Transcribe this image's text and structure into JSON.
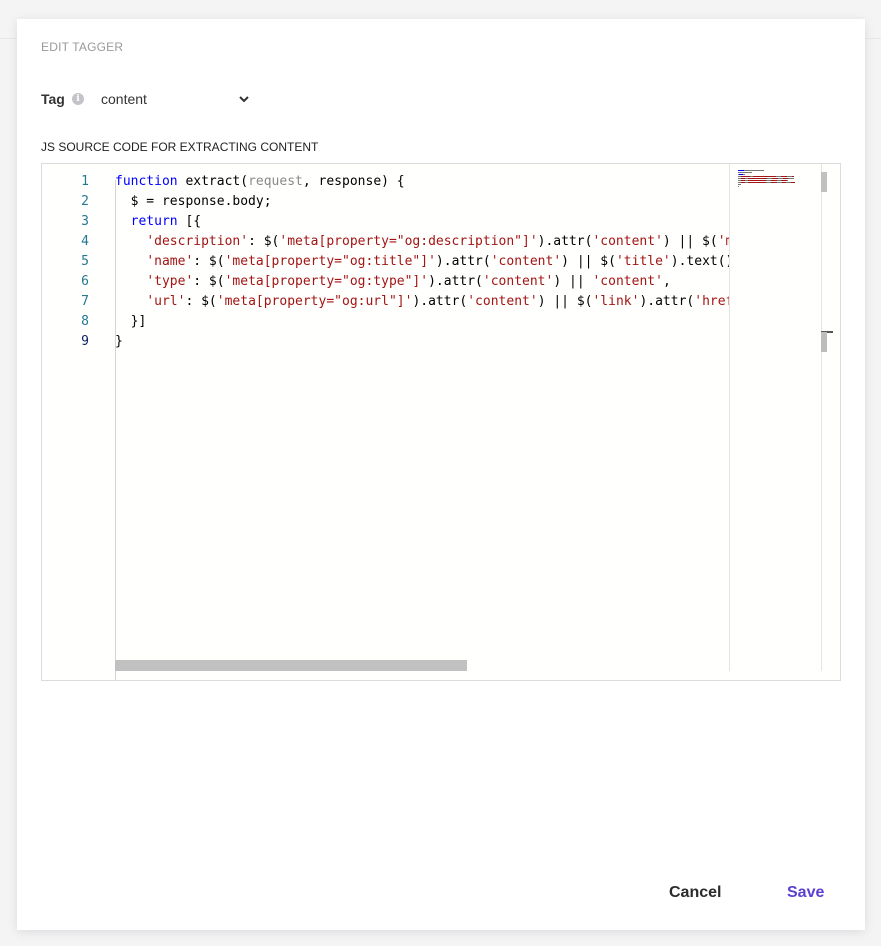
{
  "dialog": {
    "title": "EDIT TAGGER",
    "tag_label": "Tag",
    "tag_info_icon": "info-icon",
    "tag_value": "content",
    "code_label": "JS SOURCE CODE FOR EXTRACTING CONTENT"
  },
  "editor": {
    "line_numbers": [
      "1",
      "2",
      "3",
      "4",
      "5",
      "6",
      "7",
      "8",
      "9"
    ],
    "lines": [
      [
        {
          "t": "function",
          "c": "kw"
        },
        {
          "t": " extract(",
          "c": ""
        },
        {
          "t": "request",
          "c": "param"
        },
        {
          "t": ", response) ",
          "c": ""
        },
        {
          "t": "{",
          "c": ""
        }
      ],
      [
        {
          "t": "  $ = response.body;",
          "c": ""
        }
      ],
      [
        {
          "t": "  ",
          "c": ""
        },
        {
          "t": "return",
          "c": "kw"
        },
        {
          "t": " [{",
          "c": ""
        }
      ],
      [
        {
          "t": "    ",
          "c": ""
        },
        {
          "t": "'description'",
          "c": "str"
        },
        {
          "t": ": $(",
          "c": ""
        },
        {
          "t": "'meta[property=\"og:description\"]'",
          "c": "str"
        },
        {
          "t": ").attr(",
          "c": ""
        },
        {
          "t": "'content'",
          "c": "str"
        },
        {
          "t": ") || $(",
          "c": ""
        },
        {
          "t": "'me",
          "c": "str"
        }
      ],
      [
        {
          "t": "    ",
          "c": ""
        },
        {
          "t": "'name'",
          "c": "str"
        },
        {
          "t": ": $(",
          "c": ""
        },
        {
          "t": "'meta[property=\"og:title\"]'",
          "c": "str"
        },
        {
          "t": ").attr(",
          "c": ""
        },
        {
          "t": "'content'",
          "c": "str"
        },
        {
          "t": ") || $(",
          "c": ""
        },
        {
          "t": "'title'",
          "c": "str"
        },
        {
          "t": ").text(),",
          "c": ""
        }
      ],
      [
        {
          "t": "    ",
          "c": ""
        },
        {
          "t": "'type'",
          "c": "str"
        },
        {
          "t": ": $(",
          "c": ""
        },
        {
          "t": "'meta[property=\"og:type\"]'",
          "c": "str"
        },
        {
          "t": ").attr(",
          "c": ""
        },
        {
          "t": "'content'",
          "c": "str"
        },
        {
          "t": ") || ",
          "c": ""
        },
        {
          "t": "'content'",
          "c": "str"
        },
        {
          "t": ",",
          "c": ""
        }
      ],
      [
        {
          "t": "    ",
          "c": ""
        },
        {
          "t": "'url'",
          "c": "str"
        },
        {
          "t": ": $(",
          "c": ""
        },
        {
          "t": "'meta[property=\"og:url\"]'",
          "c": "str"
        },
        {
          "t": ").attr(",
          "c": ""
        },
        {
          "t": "'content'",
          "c": "str"
        },
        {
          "t": ") || $(",
          "c": ""
        },
        {
          "t": "'link'",
          "c": "str"
        },
        {
          "t": ").attr(",
          "c": ""
        },
        {
          "t": "'href'",
          "c": "str"
        }
      ],
      [
        {
          "t": "  }]",
          "c": ""
        }
      ],
      [
        {
          "t": "}",
          "c": ""
        }
      ]
    ]
  },
  "actions": {
    "cancel_label": "Cancel",
    "save_label": "Save"
  },
  "colors": {
    "accent": "#5a3fd1",
    "keyword": "#0000ff",
    "string": "#a31515",
    "line_number": "#237893"
  }
}
